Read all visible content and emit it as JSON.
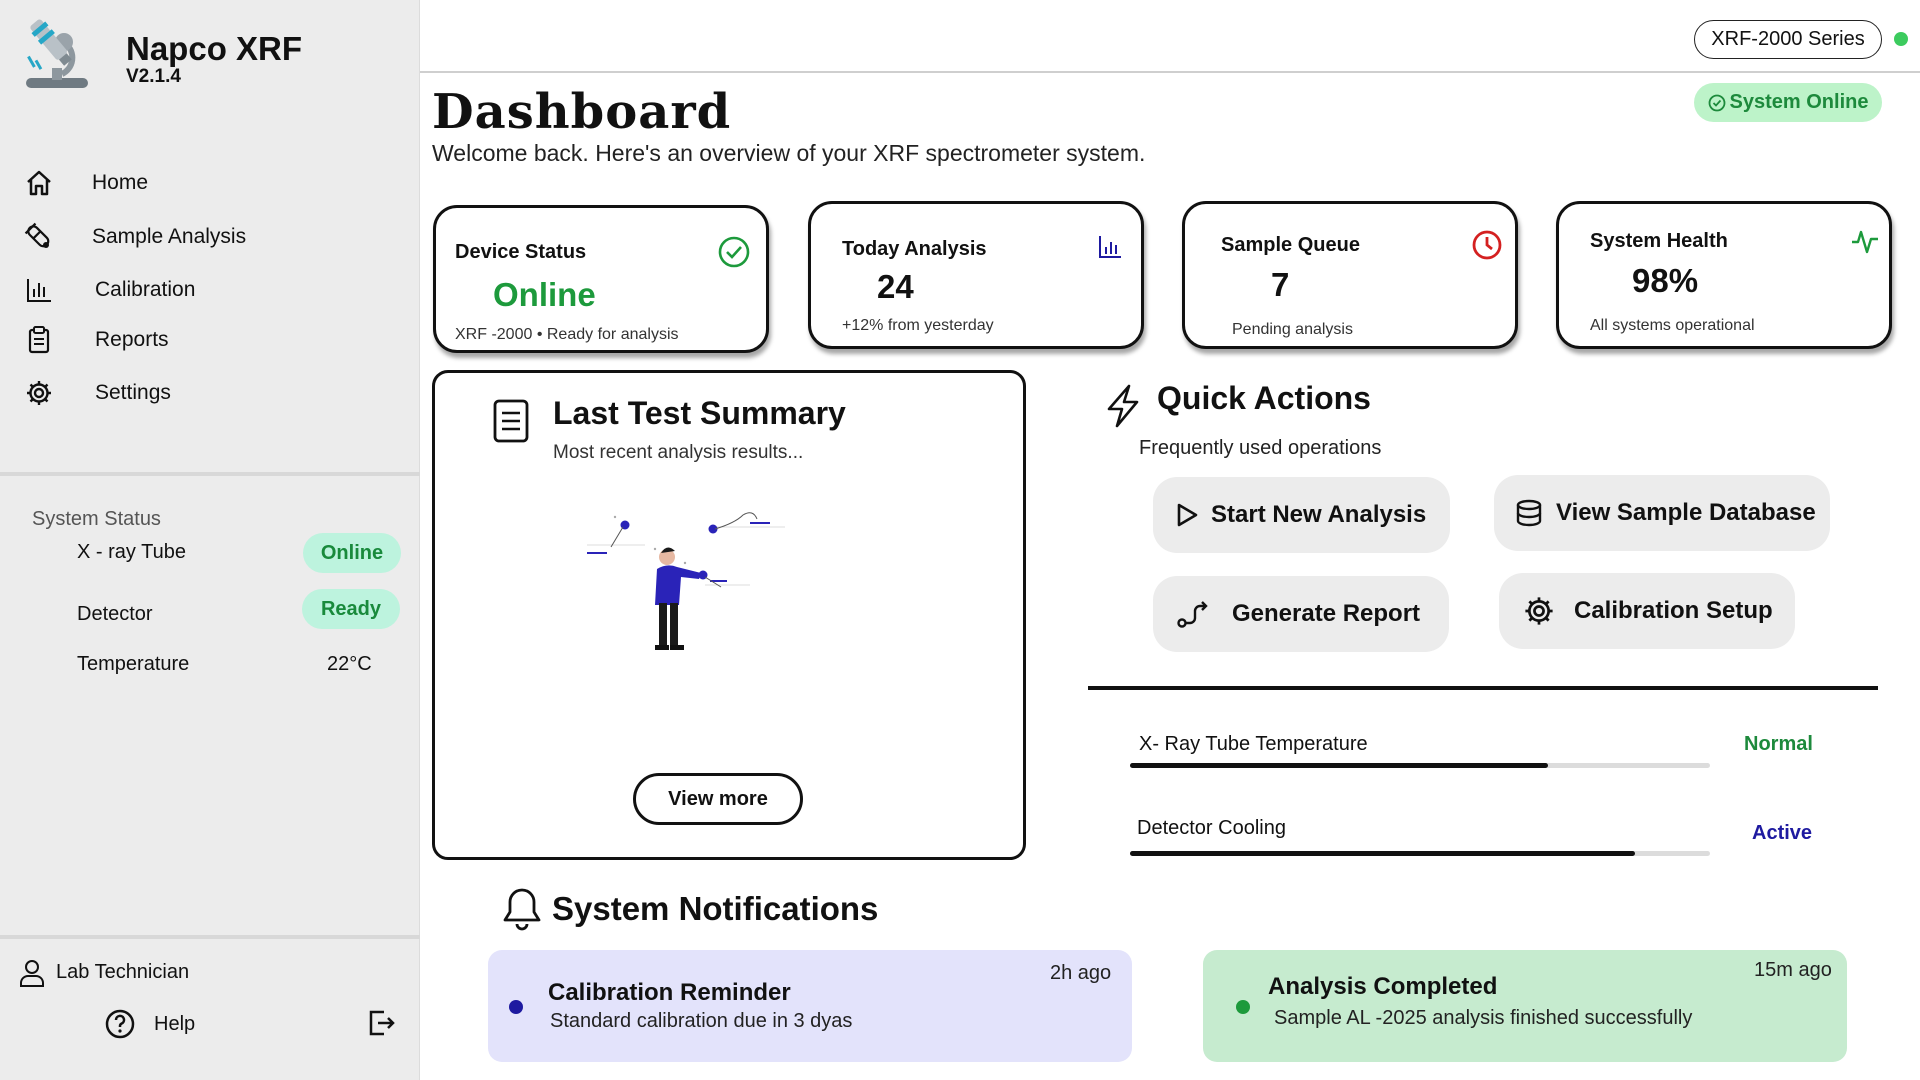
{
  "brand": {
    "name": "Napco  XRF",
    "version": "V2.1.4"
  },
  "sidebar": {
    "items": [
      {
        "label": "Home",
        "icon": "home-icon"
      },
      {
        "label": "Sample Analysis",
        "icon": "test-tube-icon"
      },
      {
        "label": "Calibration",
        "icon": "bar-chart-icon"
      },
      {
        "label": "Reports",
        "icon": "clipboard-icon"
      },
      {
        "label": "Settings",
        "icon": "gear-icon"
      }
    ],
    "system_status": {
      "title": "System Status",
      "rows": [
        {
          "label": "X - ray Tube",
          "value": "Online"
        },
        {
          "label": "Detector",
          "value": "Ready"
        },
        {
          "label": "Temperature",
          "value": "22°C"
        }
      ]
    },
    "user": "Lab Technician",
    "help": "Help"
  },
  "topbar": {
    "series": "XRF-2000 Series",
    "status": "System Online"
  },
  "header": {
    "title": "Dashboard",
    "subtitle": "Welcome back. Here's an overview of your XRF spectrometer system."
  },
  "cards": {
    "device": {
      "title": "Device Status",
      "value": "Online",
      "sub_a": "XRF -2000",
      "sub_b": "Ready for analysis"
    },
    "today": {
      "title": "Today Analysis",
      "value": "24",
      "sub": "+12% from yesterday"
    },
    "queue": {
      "title": "Sample Queue",
      "value": "7",
      "sub": "Pending analysis"
    },
    "health": {
      "title": "System Health",
      "value": "98%",
      "sub": "All systems operational"
    }
  },
  "last_test": {
    "title": "Last Test Summary",
    "subtitle": "Most recent  analysis results...",
    "button": "View more"
  },
  "quick_actions": {
    "title": "Quick Actions",
    "subtitle": "Frequently used operations",
    "buttons": [
      "Start New Analysis",
      "View Sample Database",
      "Generate Report",
      "Calibration Setup"
    ]
  },
  "monitors": [
    {
      "label": "X- Ray Tube Temperature",
      "status": "Normal",
      "level": 0.72,
      "status_color": "#1d8a3c"
    },
    {
      "label": "Detector Cooling",
      "status": "Active",
      "level": 0.87,
      "status_color": "#1e1aa0"
    }
  ],
  "notifications": {
    "title": "System Notifications",
    "items": [
      {
        "title": "Calibration Reminder",
        "desc": "Standard calibration due in 3 dyas",
        "ago": "2h ago",
        "bg": "#e3e3fb",
        "dot": "#1e1aa0"
      },
      {
        "title": "Analysis Completed",
        "desc": "Sample AL -2025 analysis finished successfully",
        "ago": "15m ago",
        "bg": "#c6ebcf",
        "dot": "#1d9a3c"
      }
    ]
  },
  "colors": {
    "green": "#1d9a3c",
    "blue": "#1e1aa0",
    "red": "#d42020"
  }
}
